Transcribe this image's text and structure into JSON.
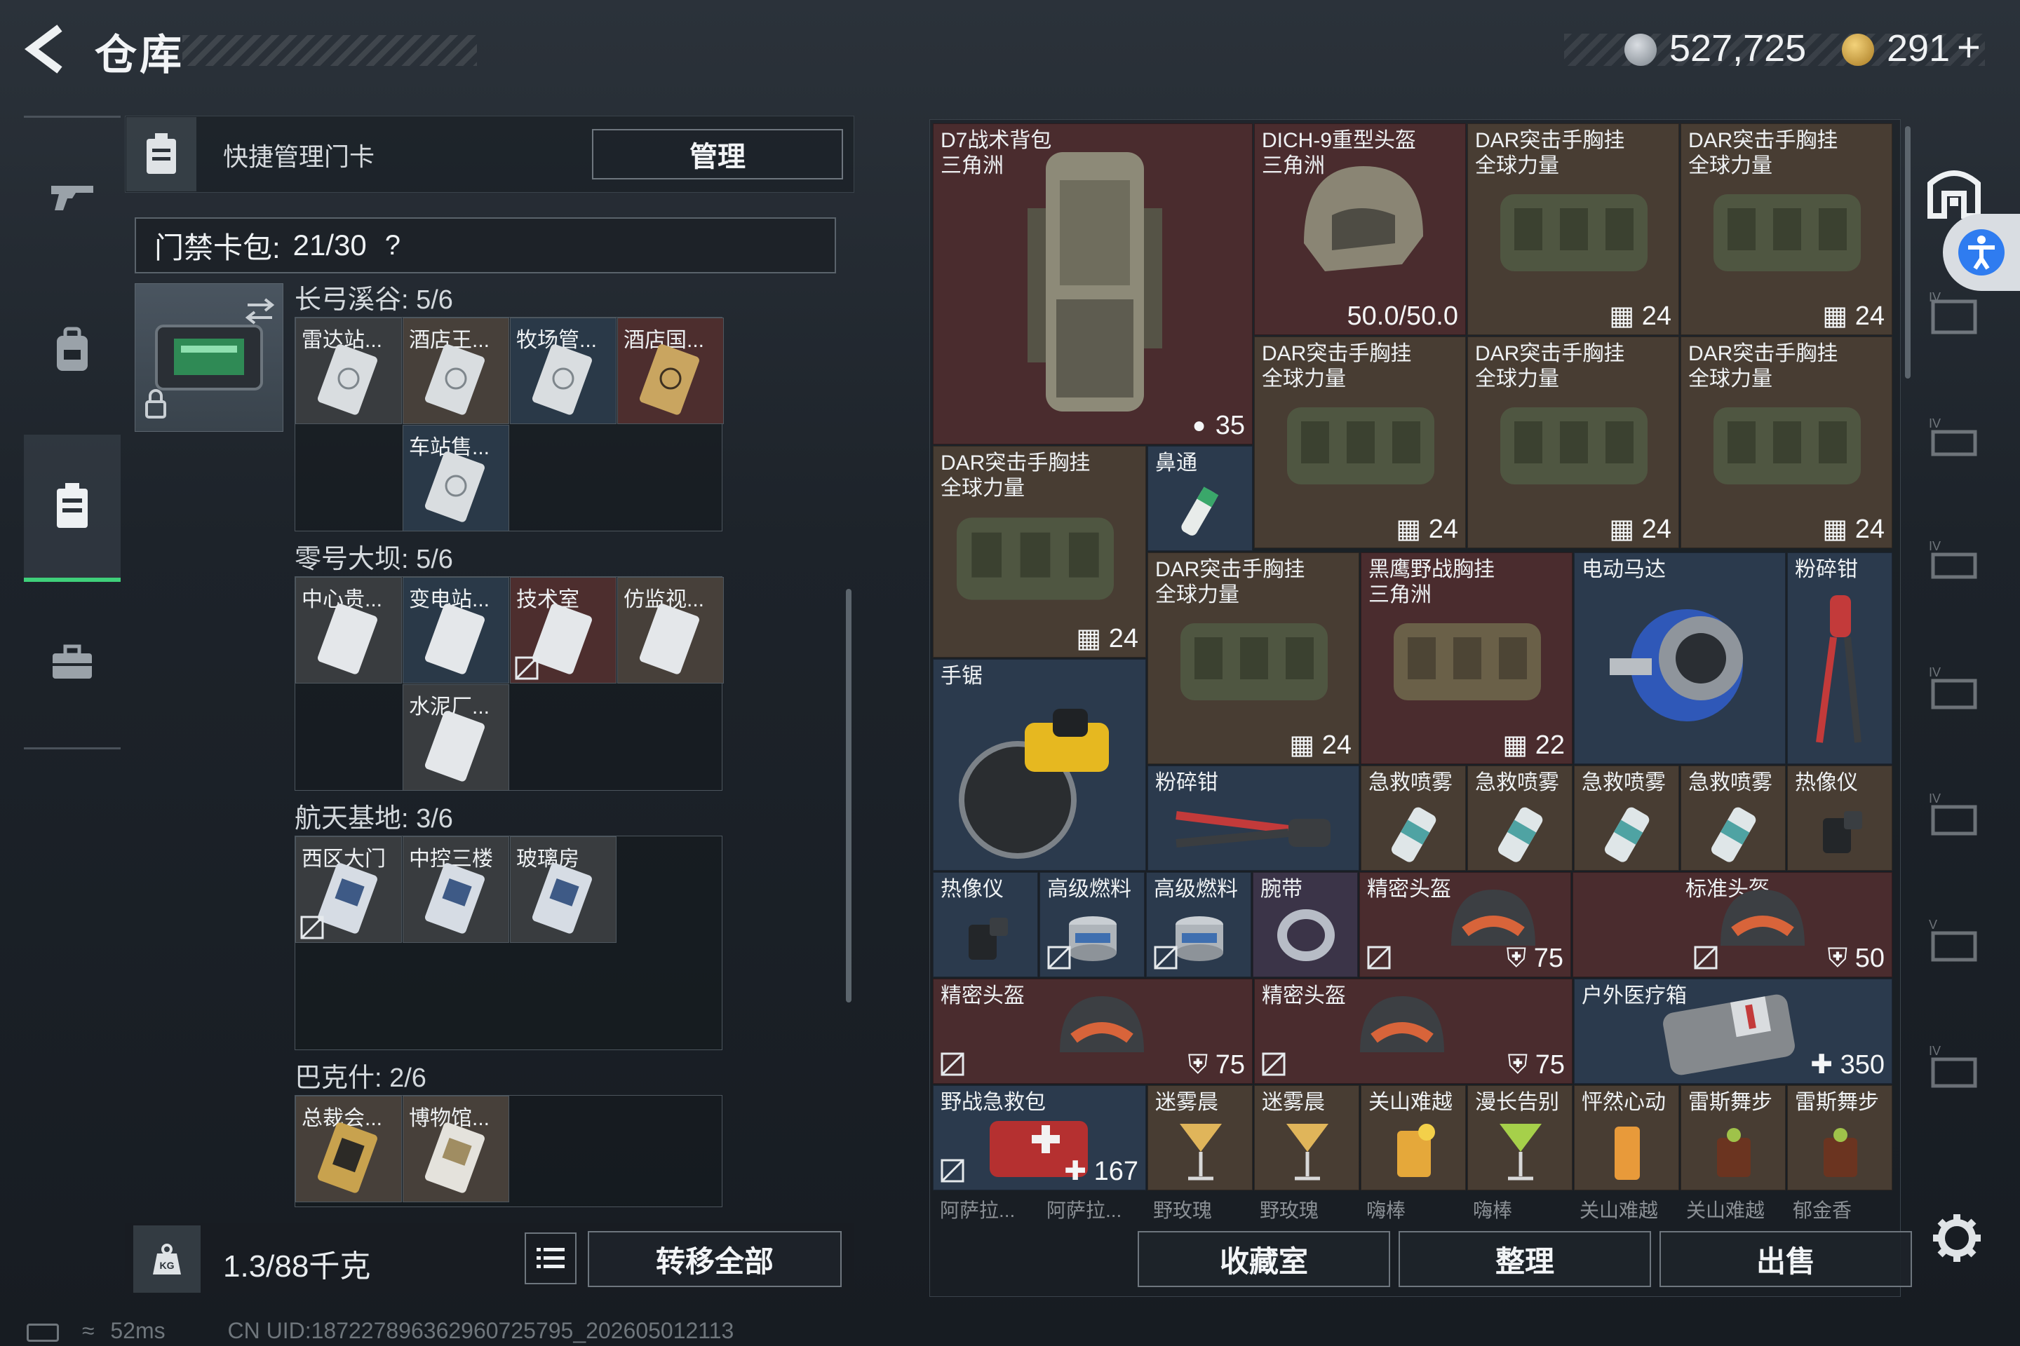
{
  "header": {
    "title": "仓库",
    "currency_1": "527,725",
    "currency_2": "291",
    "add": "+"
  },
  "left_panel": {
    "quick_manage_label": "快捷管理门卡",
    "manage_button": "管理",
    "capacity_label": "门禁卡包:",
    "capacity_value": "21/30",
    "capacity_help": "?",
    "sections": [
      {
        "label": "长弓溪谷: 5/6",
        "cards": [
          {
            "name": "雷达站...",
            "color": "gray"
          },
          {
            "name": "酒店王...",
            "color": "brown"
          },
          {
            "name": "牧场管...",
            "color": "blue"
          },
          {
            "name": "酒店国...",
            "color": "red"
          },
          {
            "name": "车站售...",
            "color": "blue"
          }
        ]
      },
      {
        "label": "零号大坝: 5/6",
        "cards": [
          {
            "name": "中心贵...",
            "color": "gray"
          },
          {
            "name": "变电站...",
            "color": "blue"
          },
          {
            "name": "技术室",
            "color": "red"
          },
          {
            "name": "仿监视...",
            "color": "brown"
          },
          {
            "name": "水泥厂...",
            "color": "gray"
          }
        ]
      },
      {
        "label": "航天基地: 3/6",
        "cards": [
          {
            "name": "西区大门",
            "color": "gray"
          },
          {
            "name": "中控三楼",
            "color": "gray"
          },
          {
            "name": "玻璃房",
            "color": "gray"
          }
        ]
      },
      {
        "label": "巴克什: 2/6",
        "cards": [
          {
            "name": "总裁会...",
            "color": "brown"
          },
          {
            "name": "博物馆...",
            "color": "brown"
          }
        ]
      }
    ],
    "weight": "1.3/88千克",
    "transfer_all_button": "转移全部"
  },
  "inventory": {
    "items": [
      {
        "name": "D7战术背包\n三角洲",
        "stat": "35",
        "bg": "red"
      },
      {
        "name": "DICH-9重型头盔\n三角洲",
        "stat": "50.0/50.0",
        "bg": "red"
      },
      {
        "name": "DAR突击手胸挂\n全球力量",
        "stat": "24",
        "bg": "brown"
      },
      {
        "name": "DAR突击手胸挂\n全球力量",
        "stat": "24",
        "bg": "brown"
      },
      {
        "name": "DAR突击手胸挂\n全球力量",
        "stat": "24",
        "bg": "brown"
      },
      {
        "name": "DAR突击手胸挂\n全球力量",
        "stat": "24",
        "bg": "brown"
      },
      {
        "name": "DAR突击手胸挂\n全球力量",
        "stat": "24",
        "bg": "brown"
      },
      {
        "name": "DAR突击手胸挂\n全球力量",
        "stat": "24",
        "bg": "brown"
      },
      {
        "name": "鼻通",
        "stat": "",
        "bg": "blue"
      },
      {
        "name": "DAR突击手胸挂\n全球力量",
        "stat": "24",
        "bg": "brown"
      },
      {
        "name": "黑鹰野战胸挂\n三角洲",
        "stat": "22",
        "bg": "red"
      },
      {
        "name": "电动马达",
        "stat": "",
        "bg": "blue"
      },
      {
        "name": "粉碎钳",
        "stat": "",
        "bg": "blue"
      },
      {
        "name": "手锯",
        "stat": "",
        "bg": "blue"
      },
      {
        "name": "粉碎钳",
        "stat": "",
        "bg": "blue"
      },
      {
        "name": "急救喷雾",
        "stat": "",
        "bg": "brown"
      },
      {
        "name": "急救喷雾",
        "stat": "",
        "bg": "brown"
      },
      {
        "name": "急救喷雾",
        "stat": "",
        "bg": "brown"
      },
      {
        "name": "急救喷雾",
        "stat": "",
        "bg": "brown"
      },
      {
        "name": "热像仪",
        "stat": "",
        "bg": "brown"
      },
      {
        "name": "热像仪",
        "stat": "",
        "bg": "blue"
      },
      {
        "name": "高级燃料",
        "stat": "",
        "bg": "blue"
      },
      {
        "name": "高级燃料",
        "stat": "",
        "bg": "blue"
      },
      {
        "name": "腕带",
        "stat": "",
        "bg": "purple"
      },
      {
        "name": "精密头盔",
        "stat": "75",
        "bg": "red"
      },
      {
        "name": "标准头盔",
        "stat": "50",
        "bg": "red"
      },
      {
        "name": "精密头盔",
        "stat": "75",
        "bg": "red"
      },
      {
        "name": "精密头盔",
        "stat": "75",
        "bg": "red"
      },
      {
        "name": "户外医疗箱",
        "stat": "350",
        "bg": "blue"
      },
      {
        "name": "野战急救包",
        "stat": "167",
        "bg": "blue"
      },
      {
        "name": "迷雾晨",
        "stat": "",
        "bg": "brown"
      },
      {
        "name": "迷雾晨",
        "stat": "",
        "bg": "brown"
      },
      {
        "name": "关山难越",
        "stat": "",
        "bg": "brown"
      },
      {
        "name": "漫长告别",
        "stat": "",
        "bg": "brown"
      },
      {
        "name": "怦然心动",
        "stat": "",
        "bg": "brown"
      },
      {
        "name": "雷斯舞步",
        "stat": "",
        "bg": "brown"
      },
      {
        "name": "雷斯舞步",
        "stat": "",
        "bg": "brown"
      }
    ],
    "peek_row": [
      "阿萨拉...",
      "阿萨拉...",
      "野玫瑰",
      "野玫瑰",
      "嗨棒",
      "嗨棒",
      "关山难越",
      "关山难越",
      "郁金香"
    ],
    "buttons": {
      "collection": "收藏室",
      "sort": "整理",
      "sell": "出售"
    }
  },
  "status_bar": {
    "ping": "52ms",
    "uid": "CN UID:18722789636296072579​5_202605012113"
  },
  "colors": {
    "accent_green": "#3fd07a",
    "red_rarity": "#4a2c2e",
    "brown_rarity": "#483d33",
    "blue_rarity": "#2b3a4d",
    "purple_rarity": "#3b3448"
  }
}
